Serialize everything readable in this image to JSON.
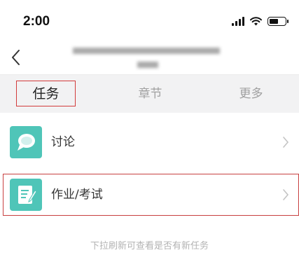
{
  "status_bar": {
    "time": "2:00",
    "icons": [
      "signal-icon",
      "wifi-icon",
      "battery-icon"
    ],
    "battery_level": 0.6
  },
  "nav": {
    "back_icon": "chevron-left-icon",
    "title_blurred": true
  },
  "tabs": [
    {
      "label": "任务",
      "active": true
    },
    {
      "label": "章节",
      "active": false
    },
    {
      "label": "更多",
      "active": false
    }
  ],
  "items": [
    {
      "label": "讨论",
      "icon": "chat-bubble-icon"
    },
    {
      "label": "作业/考试",
      "icon": "assignment-icon"
    }
  ],
  "hint": "下拉刷新可查看是否有新任务",
  "colors": {
    "accent": "#4fc5b8",
    "highlight": "#d23b3b",
    "tab_bar_bg": "#f2f2f3"
  }
}
